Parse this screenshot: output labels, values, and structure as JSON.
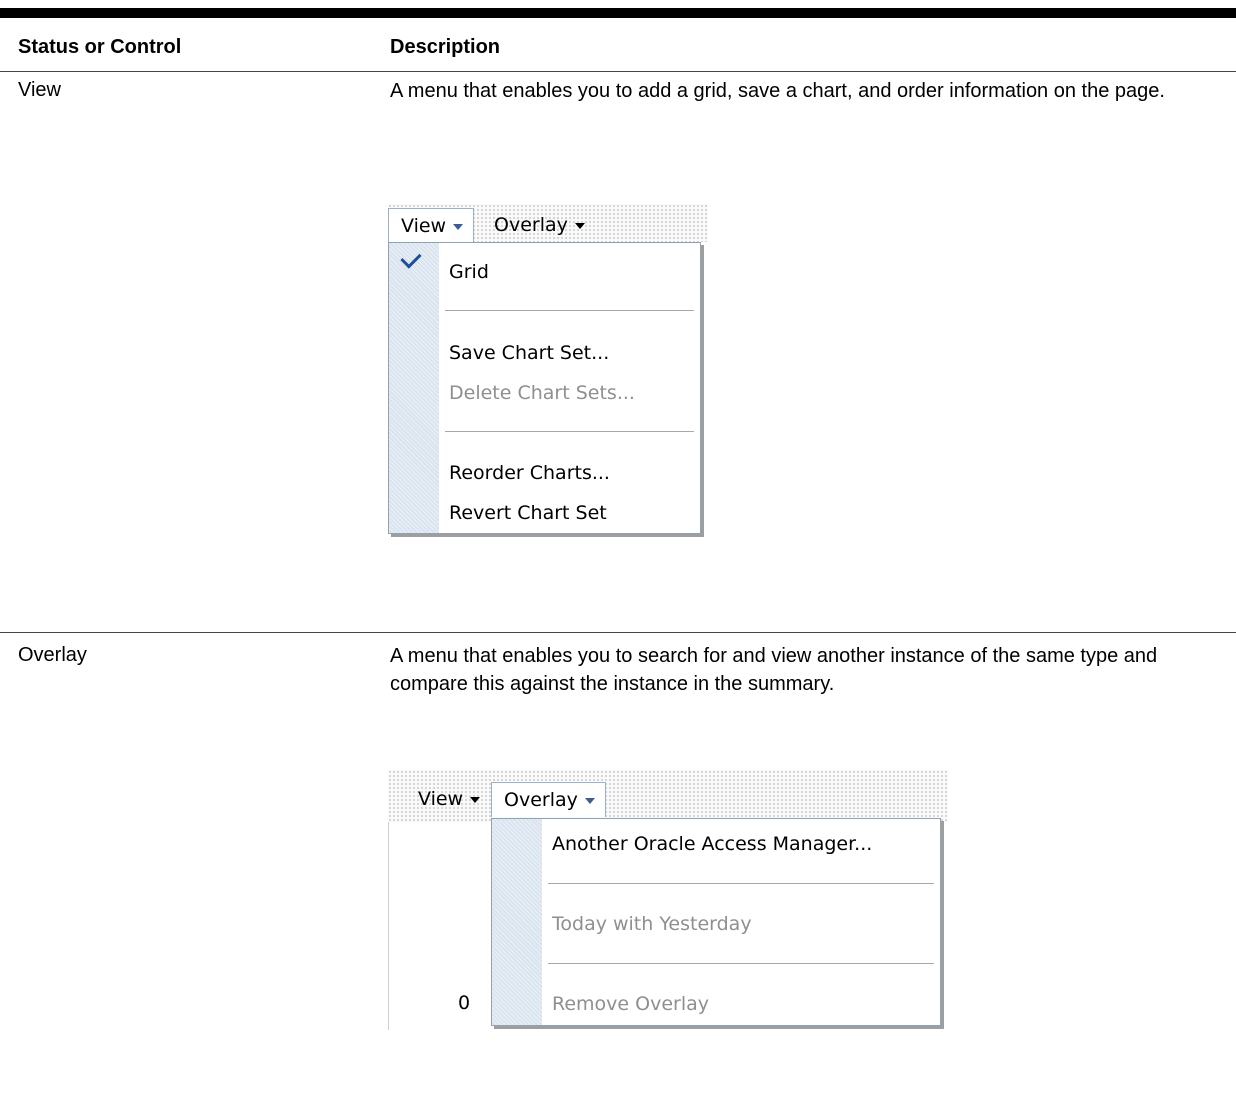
{
  "table": {
    "headers": [
      "Status or Control",
      "Description"
    ],
    "rows": [
      {
        "name": "View",
        "description": "A menu that enables you to add a grid, save a chart, and order information on the page."
      },
      {
        "name": "Overlay",
        "description": "A menu that enables you to search for and view another instance of the same type and compare this against the instance in the summary."
      }
    ]
  },
  "view_screenshot": {
    "menubar": {
      "view": "View",
      "overlay": "Overlay"
    },
    "menu_items": [
      {
        "label": "Grid",
        "checked": true,
        "disabled": false
      },
      {
        "label": "Save Chart Set...",
        "disabled": false
      },
      {
        "label": "Delete Chart Sets...",
        "disabled": true
      },
      {
        "label": "Reorder Charts...",
        "disabled": false
      },
      {
        "label": "Revert Chart Set",
        "disabled": false
      }
    ]
  },
  "overlay_screenshot": {
    "menubar": {
      "view": "View",
      "overlay": "Overlay"
    },
    "axis_label": "0",
    "menu_items": [
      {
        "label": "Another Oracle Access Manager...",
        "disabled": false
      },
      {
        "label": "Today with Yesterday",
        "disabled": true
      },
      {
        "label": "Remove Overlay",
        "disabled": true
      }
    ]
  },
  "colors": {
    "menu_gutter": "#d9e4ef",
    "menu_border": "#8fa2b6",
    "check": "#1f4f9a",
    "disabled_text": "#8f8f8f"
  }
}
